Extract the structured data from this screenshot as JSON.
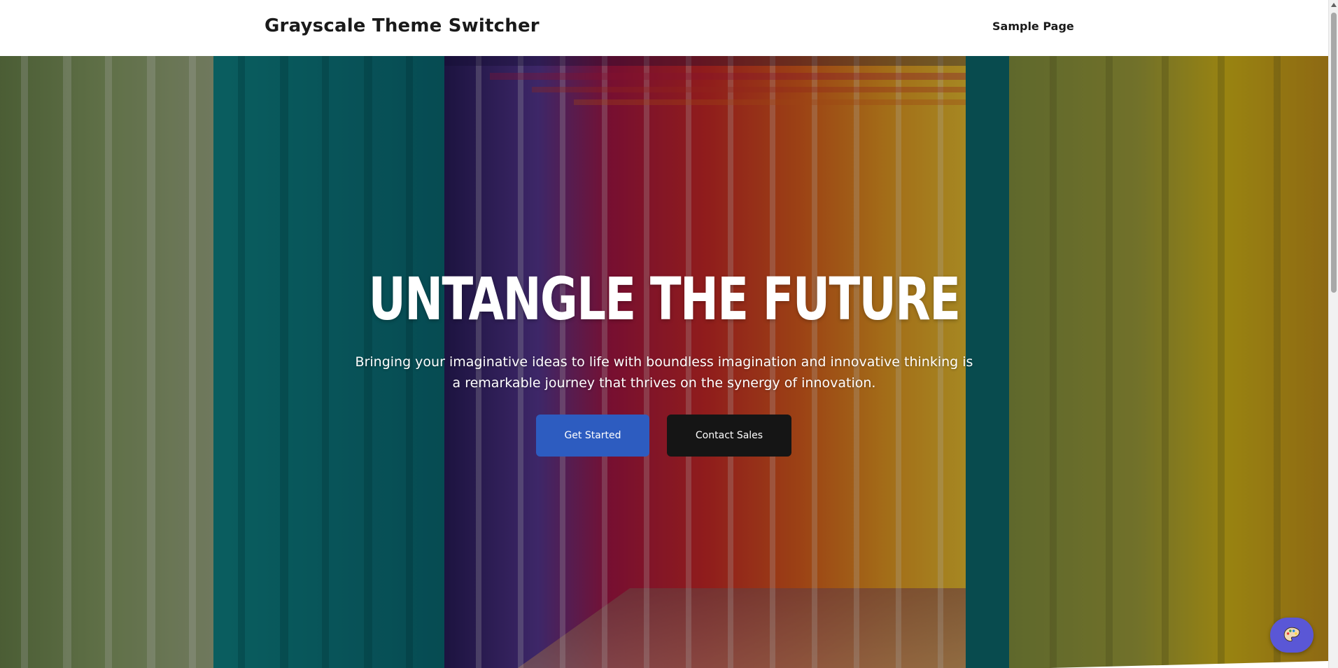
{
  "header": {
    "site_title": "Grayscale Theme Switcher",
    "nav": [
      {
        "label": "Sample Page"
      }
    ]
  },
  "hero": {
    "title": "UNTANGLE THE FUTURE",
    "subtitle": "Bringing your imaginative ideas to life with boundless imagination and innovative thinking is a remarkable journey that thrives on the synergy of innovation.",
    "primary_button": "Get Started",
    "secondary_button": "Contact Sales",
    "background_image": "colorful-corridor-photo"
  },
  "theme_switcher": {
    "icon": "palette-icon"
  },
  "colors": {
    "primary_button": "#2d5cc0",
    "secondary_button": "#151515",
    "theme_switcher": "#5a57d6",
    "header_background": "#ffffff"
  }
}
